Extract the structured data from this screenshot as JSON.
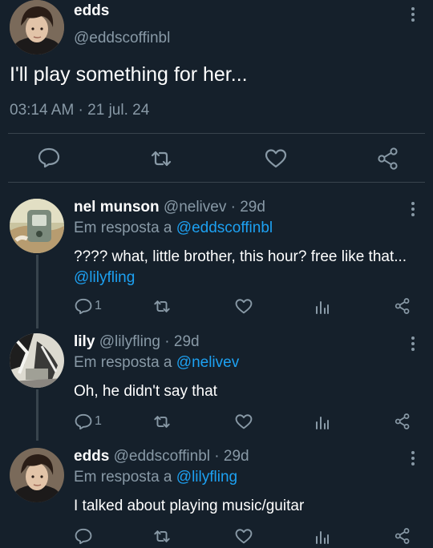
{
  "main_tweet": {
    "display_name": "edds",
    "handle": "@eddscoffinbl",
    "text": "I'll play something for her...",
    "timestamp": "03:14 AM · 21 jul. 24"
  },
  "replies": [
    {
      "display_name": "nel munson",
      "meta": "@nelivev · 29d",
      "reply_prefix": "Em resposta a",
      "reply_to": "@eddscoffinbl",
      "text": "???? what, little brother, this hour? free like that...",
      "mention": "@lilyfling",
      "reply_count": "1"
    },
    {
      "display_name": "lily",
      "meta": "@lilyfling · 29d",
      "reply_prefix": "Em resposta a",
      "reply_to": "@nelivev",
      "text": "Oh, he didn't say that",
      "reply_count": "1"
    },
    {
      "display_name": "edds",
      "meta": "@eddscoffinbl · 29d",
      "reply_prefix": "Em resposta a",
      "reply_to": "@lilyfling",
      "text": "I talked about playing music/guitar"
    }
  ],
  "colors": {
    "background": "#15202b",
    "muted": "#8899a6",
    "link": "#1da1f2",
    "divider": "#38444d"
  },
  "icons": [
    "more-vertical-icon",
    "reply-icon",
    "retweet-icon",
    "like-icon",
    "share-icon",
    "analytics-icon"
  ]
}
